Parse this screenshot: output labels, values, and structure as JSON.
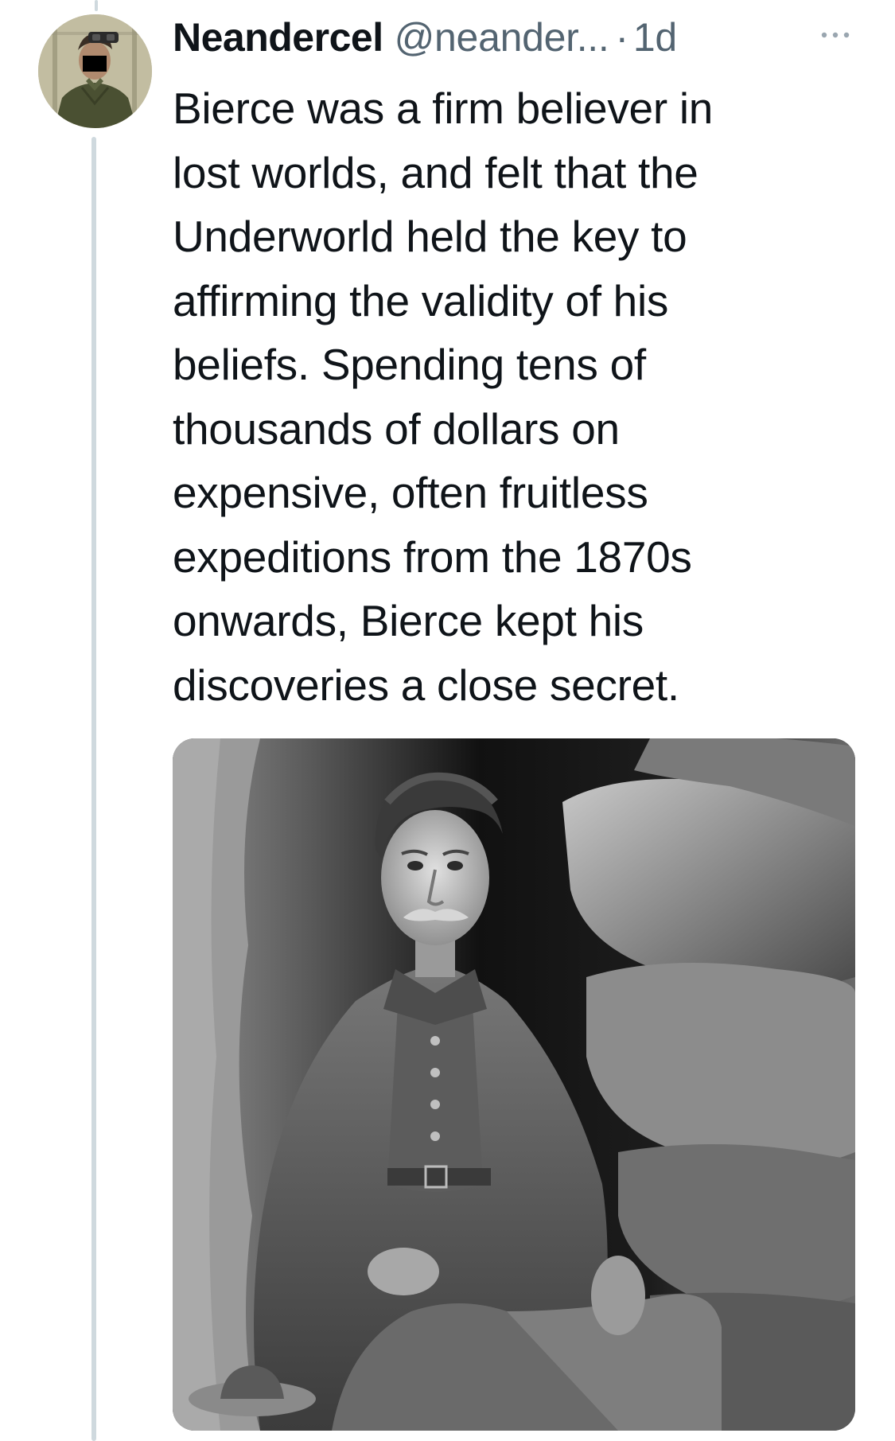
{
  "tweet": {
    "display_name": "Neandercel",
    "handle": "@neander...",
    "separator": "·",
    "timestamp": "1d",
    "text": "Bierce was a firm believer in\nlost worlds, and felt that the\nUnderworld held the key to\naffirming the validity of his\nbeliefs. Spending tens of\nthousands of dollars on\nexpensive, often fruitless\nexpeditions from the 1870s\nonwards, Bierce kept his\ndiscoveries a close secret.",
    "more_icon": "more-horizontal-icon",
    "media_type": "black-and-white photograph"
  },
  "colors": {
    "text_primary": "#0f1419",
    "text_secondary": "#536471",
    "thread_line": "#cfd9de",
    "background": "#ffffff"
  }
}
